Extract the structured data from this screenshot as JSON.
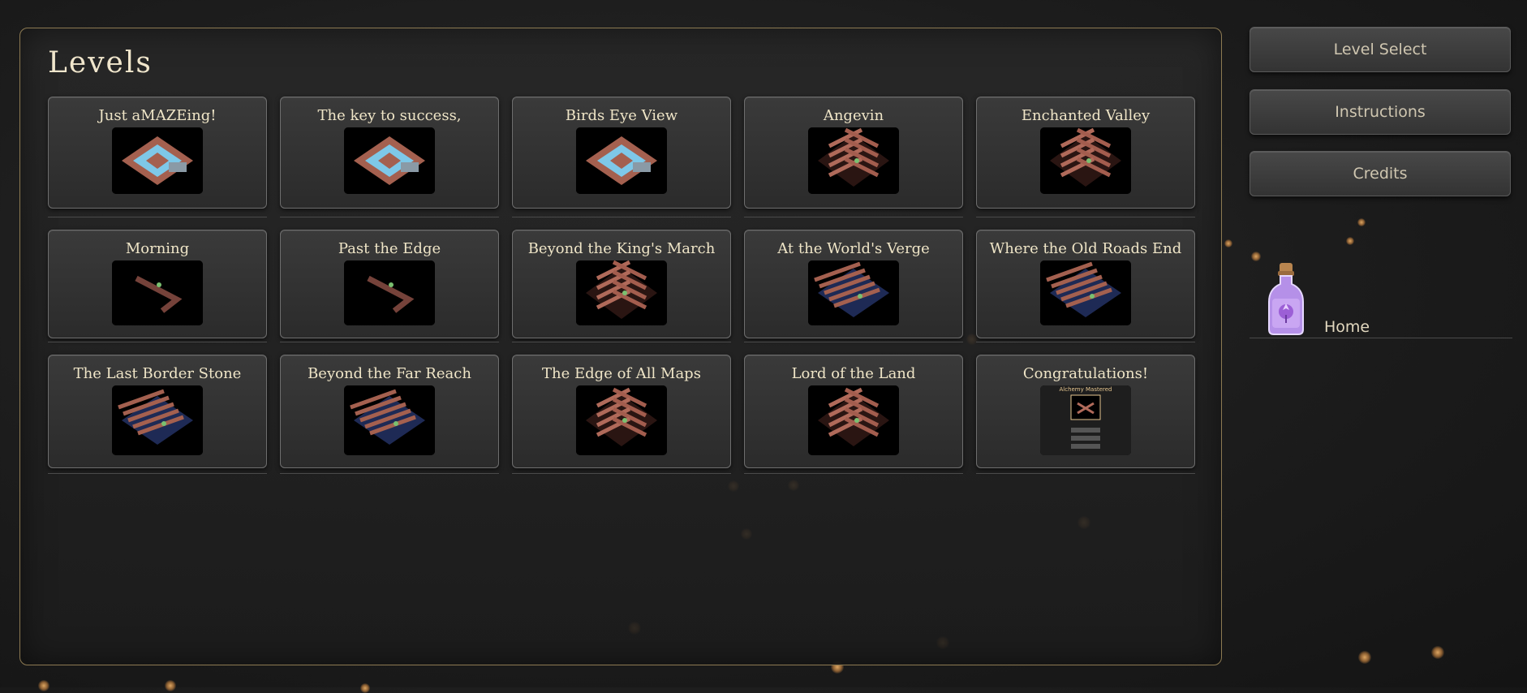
{
  "panel": {
    "title": "Levels"
  },
  "levels": [
    {
      "title": "Just aMAZEing!",
      "theme": "water"
    },
    {
      "title": "The key to success,",
      "theme": "water"
    },
    {
      "title": "Birds Eye View",
      "theme": "water"
    },
    {
      "title": "Angevin",
      "theme": "maze"
    },
    {
      "title": "Enchanted Valley",
      "theme": "maze"
    },
    {
      "title": "Morning",
      "theme": "path"
    },
    {
      "title": "Past the Edge",
      "theme": "path"
    },
    {
      "title": "Beyond the King's March",
      "theme": "maze"
    },
    {
      "title": "At the World's Verge",
      "theme": "blue"
    },
    {
      "title": "Where the Old Roads End",
      "theme": "blue"
    },
    {
      "title": "The Last Border Stone",
      "theme": "blue"
    },
    {
      "title": "Beyond the Far Reach",
      "theme": "blue"
    },
    {
      "title": "The Edge of All Maps",
      "theme": "maze"
    },
    {
      "title": "Lord of the Land",
      "theme": "maze"
    },
    {
      "title": "Congratulations!",
      "theme": "final"
    }
  ],
  "final_thumb": {
    "heading": "Alchemy Mastered"
  },
  "sidebar": {
    "buttons": [
      "Level Select",
      "Instructions",
      "Credits"
    ],
    "home_label": "Home"
  },
  "colors": {
    "accent_border": "#8d7a52",
    "text": "#efe5c7",
    "brick": "#b06a5a",
    "water": "#7ec8e8"
  }
}
